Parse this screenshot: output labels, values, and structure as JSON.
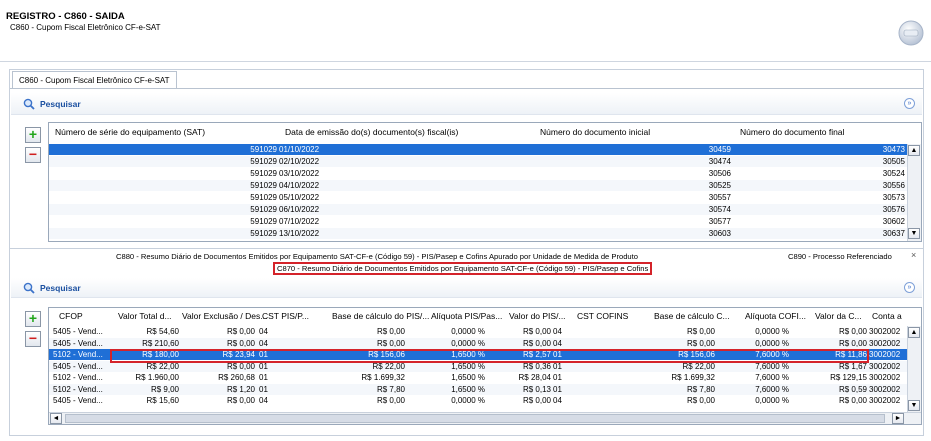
{
  "header": {
    "title": "REGISTRO - C860 - SAIDA",
    "subtitle": "C860 - Cupom Fiscal Eletrônico CF-e-SAT"
  },
  "top_tab": {
    "label": "C860 - Cupom Fiscal Eletrônico CF-e-SAT"
  },
  "search1": {
    "label": "Pesquisar"
  },
  "grid1": {
    "columns": [
      "Número de série do equipamento (SAT)",
      "Data de emissão do(s) documento(s) fiscal(is)",
      "Número do documento inicial",
      "Número do documento final"
    ],
    "rows": [
      [
        "591029",
        "01/10/2022",
        "30459",
        "30473"
      ],
      [
        "591029",
        "02/10/2022",
        "30474",
        "30505"
      ],
      [
        "591029",
        "03/10/2022",
        "30506",
        "30524"
      ],
      [
        "591029",
        "04/10/2022",
        "30525",
        "30556"
      ],
      [
        "591029",
        "05/10/2022",
        "30557",
        "30573"
      ],
      [
        "591029",
        "06/10/2022",
        "30574",
        "30576"
      ],
      [
        "591029",
        "07/10/2022",
        "30577",
        "30602"
      ],
      [
        "591029",
        "13/10/2022",
        "30603",
        "30637"
      ]
    ]
  },
  "bottom_tabs": {
    "c880": "C880 - Resumo Diário de Documentos Emitidos por Equipamento SAT-CF-e (Código 59) - PIS/Pasep e Cofins Apurado por Unidade de Medida de Produto",
    "c890": "C890 - Processo Referenciado",
    "close": "×",
    "c870": "C870 - Resumo Diário de Documentos Emitidos por Equipamento SAT-CF-e (Código 59) - PIS/Pasep e Cofins"
  },
  "search2": {
    "label": "Pesquisar"
  },
  "grid2": {
    "columns": [
      "CFOP",
      "Valor Total d...",
      "Valor Exclusão / Des...",
      "CST PIS/P...",
      "Base de cálculo do PIS/...",
      "Alíquota PIS/Pas...",
      "Valor do PIS/...",
      "CST COFINS",
      "Base de cálculo C...",
      "Alíquota COFI...",
      "Valor da C...",
      "Conta a"
    ],
    "rows": [
      [
        "5405 - Vend...",
        "R$ 54,60",
        "R$ 0,00",
        "04",
        "R$ 0,00",
        "0,0000 %",
        "R$ 0,00",
        "04",
        "R$ 0,00",
        "0,0000 %",
        "R$ 0,00",
        "3002002"
      ],
      [
        "5405 - Vend...",
        "R$ 210,60",
        "R$ 0,00",
        "04",
        "R$ 0,00",
        "0,0000 %",
        "R$ 0,00",
        "04",
        "R$ 0,00",
        "0,0000 %",
        "R$ 0,00",
        "3002002"
      ],
      [
        "5102 - Vend...",
        "R$ 180,00",
        "R$ 23,94",
        "01",
        "R$ 156,06",
        "1,6500 %",
        "R$ 2,57",
        "01",
        "R$ 156,06",
        "7,6000 %",
        "R$ 11,86",
        "3002002"
      ],
      [
        "5405 - Vend...",
        "R$ 22,00",
        "R$ 0,00",
        "01",
        "R$ 22,00",
        "1,6500 %",
        "R$ 0,36",
        "01",
        "R$ 22,00",
        "7,6000 %",
        "R$ 1,67",
        "3002002"
      ],
      [
        "5102 - Vend...",
        "R$ 1.960,00",
        "R$ 260,68",
        "01",
        "R$ 1.699,32",
        "1,6500 %",
        "R$ 28,04",
        "01",
        "R$ 1.699,32",
        "7,6000 %",
        "R$ 129,15",
        "3002002"
      ],
      [
        "5102 - Vend...",
        "R$ 9,00",
        "R$ 1,20",
        "01",
        "R$ 7,80",
        "1,6500 %",
        "R$ 0,13",
        "01",
        "R$ 7,80",
        "7,6000 %",
        "R$ 0,59",
        "3002002"
      ],
      [
        "5405 - Vend...",
        "R$ 15,60",
        "R$ 0,00",
        "04",
        "R$ 0,00",
        "0,0000 %",
        "R$ 0,00",
        "04",
        "R$ 0,00",
        "0,0000 %",
        "R$ 0,00",
        "3002002"
      ]
    ]
  },
  "colors": {
    "selection": "#1f6fd6",
    "highlight_border": "#d4232a",
    "search_label": "#1a4fa0"
  }
}
